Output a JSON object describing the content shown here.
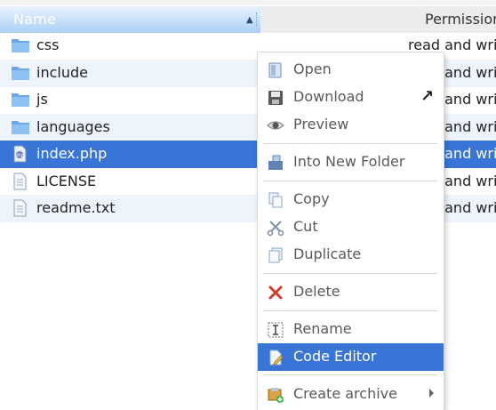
{
  "header": {
    "name_label": "Name",
    "permissions_label": "Permissions",
    "sort_indicator": "▲"
  },
  "files": [
    {
      "name": "css",
      "permissions": "read and write",
      "kind": "folder-icon"
    },
    {
      "name": "include",
      "permissions": "read and write",
      "kind": "folder-icon"
    },
    {
      "name": "js",
      "permissions": "read and write",
      "kind": "folder-icon"
    },
    {
      "name": "languages",
      "permissions": "read and write",
      "kind": "folder-icon"
    },
    {
      "name": "index.php",
      "permissions": "read and write",
      "kind": "php-file-icon",
      "selected": true
    },
    {
      "name": "LICENSE",
      "permissions": "read and write",
      "kind": "text-file-icon"
    },
    {
      "name": "readme.txt",
      "permissions": "read and write",
      "kind": "text-file-icon"
    }
  ],
  "context_menu": {
    "items": [
      {
        "label": "Open",
        "icon": "open-icon"
      },
      {
        "label": "Download",
        "icon": "download-icon",
        "extra": "↗"
      },
      {
        "label": "Preview",
        "icon": "eye-icon"
      },
      {
        "label": "Into New Folder",
        "icon": "new-folder-icon"
      },
      {
        "label": "Copy",
        "icon": "copy-icon"
      },
      {
        "label": "Cut",
        "icon": "scissors-icon"
      },
      {
        "label": "Duplicate",
        "icon": "duplicate-icon"
      },
      {
        "label": "Delete",
        "icon": "delete-icon"
      },
      {
        "label": "Rename",
        "icon": "rename-icon"
      },
      {
        "label": "Code Editor",
        "icon": "code-editor-icon",
        "highlighted": true
      },
      {
        "label": "Create archive",
        "icon": "archive-icon",
        "submenu": true
      }
    ]
  },
  "colors": {
    "selection": "#3875d7",
    "header_gradient_top": "#e9f3ff",
    "header_gradient_bottom": "#a9d0f5",
    "alt_row": "#eef4fc"
  }
}
